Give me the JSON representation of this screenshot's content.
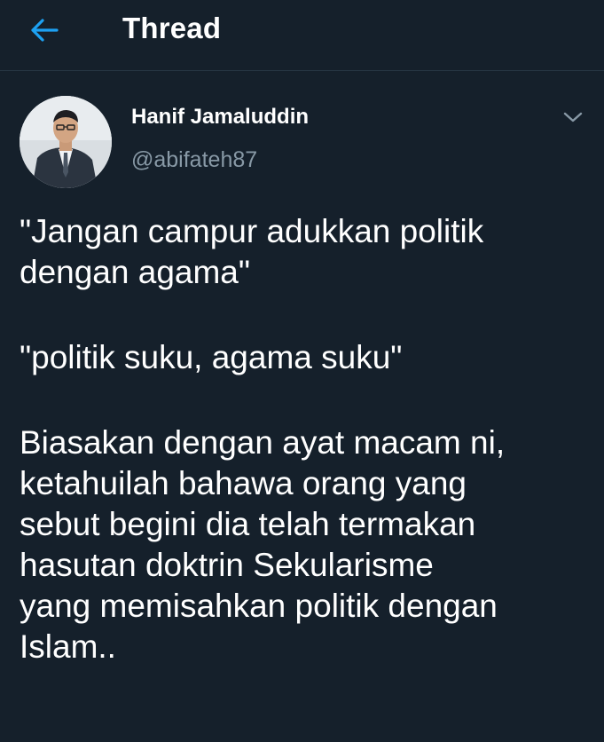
{
  "header": {
    "title": "Thread",
    "back_icon": "arrow-left-icon",
    "accent_color": "#1da1f2"
  },
  "tweet": {
    "author": {
      "name": "Hanif Jamaluddin",
      "handle": "@abifateh87",
      "avatar_icon": "avatar-photo"
    },
    "menu_icon": "chevron-down-icon",
    "paragraphs": [
      "\"Jangan campur adukkan politik\ndengan agama\"",
      "\"politik suku, agama suku\"",
      "Biasakan dengan ayat macam ni,\nketahuilah bahawa orang yang\nsebut begini dia telah termakan\nhasutan doktrin Sekularisme\nyang memisahkan politik dengan\nIslam.."
    ]
  },
  "colors": {
    "background": "#15202b",
    "text_primary": "#ffffff",
    "text_secondary": "#8899a6",
    "divider": "#263543"
  }
}
